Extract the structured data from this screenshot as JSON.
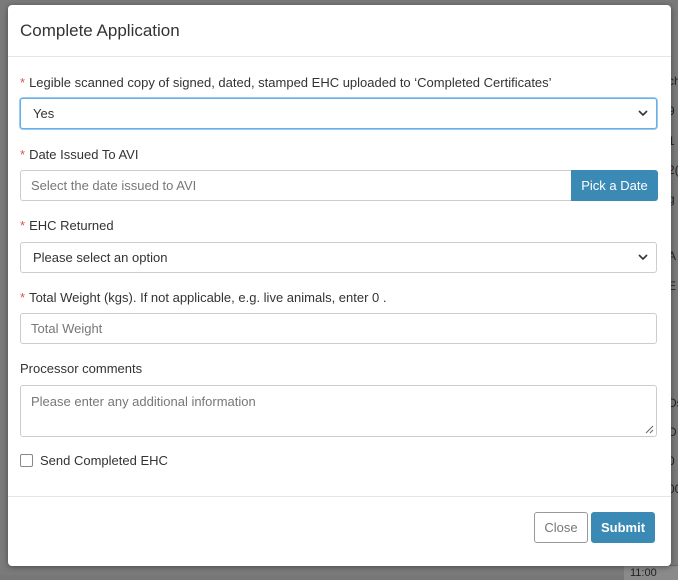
{
  "background": {
    "cells": [
      "ch",
      "9",
      "1",
      "2(",
      "g",
      "A",
      "E",
      "Ds",
      "D",
      "0",
      "00"
    ],
    "bottom_time": "11:00"
  },
  "modal": {
    "title": "Complete Application",
    "fields": {
      "legible_copy": {
        "label": "Legible scanned copy of signed, dated, stamped EHC uploaded to ‘Completed Certificates’",
        "value": "Yes"
      },
      "date_issued": {
        "label": "Date Issued To AVI",
        "placeholder": "Select the date issued to AVI",
        "button": "Pick a Date"
      },
      "ehc_returned": {
        "label": "EHC Returned",
        "value": "Please select an option"
      },
      "total_weight": {
        "label": "Total Weight (kgs). If not applicable, e.g. live animals, enter 0 .",
        "placeholder": "Total Weight"
      },
      "processor_comments": {
        "label": "Processor comments",
        "placeholder": "Please enter any additional information"
      },
      "send_completed": {
        "label": "Send Completed EHC",
        "checked": false
      }
    },
    "required_marker": "*",
    "footer": {
      "close": "Close",
      "submit": "Submit"
    }
  },
  "colors": {
    "accent": "#3a8ab5",
    "required": "#d9534f",
    "focus_border": "#66afe9"
  }
}
